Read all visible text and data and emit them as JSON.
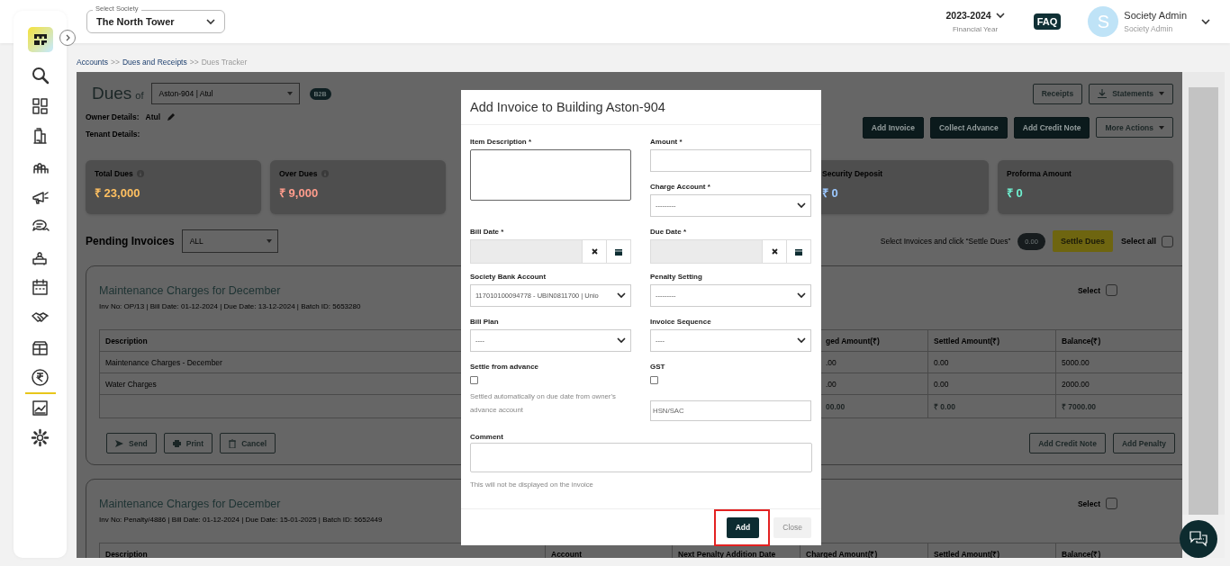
{
  "topbar": {
    "society_select": {
      "label": "Select Society",
      "value": "The North Tower"
    },
    "financial_year": {
      "value": "2023-2024",
      "caption": "Financial Year"
    },
    "faq": "FAQ",
    "user": {
      "initial": "S",
      "name": "Society Admin",
      "role": "Society Admin"
    }
  },
  "sidebar": {
    "items": [
      {
        "selected": false
      },
      {
        "selected": false
      },
      {
        "selected": false
      },
      {
        "selected": false
      },
      {
        "selected": false
      },
      {
        "selected": false
      },
      {
        "selected": false
      },
      {
        "selected": false
      },
      {
        "selected": false
      },
      {
        "selected": false
      },
      {
        "selected": true
      },
      {
        "selected": false
      },
      {
        "selected": false
      }
    ]
  },
  "breadcrumb": [
    {
      "label": "Accounts",
      "kind": "link"
    },
    {
      "label": ">>",
      "kind": "separator"
    },
    {
      "label": "Dues and Receipts",
      "kind": "link"
    },
    {
      "label": ">>",
      "kind": "separator"
    },
    {
      "label": "Dues Tracker",
      "kind": "current"
    }
  ],
  "dues": {
    "title": "Dues",
    "of": "of",
    "unit_select": "Aston-904 | Atul",
    "badge": "B2B",
    "owner_label": "Owner Details:",
    "owner": "Atul",
    "tenant_label": "Tenant Details:",
    "top_buttons": [
      {
        "label": "Receipts",
        "kind": "outline"
      },
      {
        "label": "Statements",
        "kind": "download"
      }
    ],
    "actions": [
      {
        "label": "Add Invoice",
        "kind": "solid"
      },
      {
        "label": "Collect Advance",
        "kind": "solid"
      },
      {
        "label": "Add Credit Note",
        "kind": "solid"
      },
      {
        "label": "More Actions",
        "kind": "dropdown"
      }
    ]
  },
  "summary_cards": [
    {
      "title": "Total Dues",
      "info": true,
      "value": "₹ 23,000",
      "color": "#ffc061"
    },
    {
      "title": "Over Dues",
      "info": true,
      "value": "₹ 9,000",
      "color": "#ff9c8c"
    },
    {
      "title": "Security Deposit",
      "info": false,
      "value": "₹ 0",
      "color": "#9cc8ff"
    },
    {
      "title": "Proforma Amount",
      "info": false,
      "value": "₹ 0",
      "color": "#6ff0d0"
    }
  ],
  "pending": {
    "title": "Pending Invoices",
    "filter": "ALL",
    "hint": "Select Invoices and click “Settle Dues”",
    "total": "0.00",
    "settle_button": "Settle Dues",
    "select_all_label": "Select all",
    "select_all_checked": false
  },
  "invoices": [
    {
      "title": "Maintenance Charges for December",
      "meta": "Inv No: OP/13 | Bill Date: 01-12-2024 | Due Date: 13-12-2024 | Batch ID: 5653280",
      "select_label": "Select",
      "checked": false,
      "columns": {
        "description": "Description",
        "charged_amount": "ged Amount(₹)",
        "settled_amount": "Settled Amount(₹)",
        "balance": "Balance(₹)"
      },
      "rows": [
        {
          "description": "Maintenance Charges - December",
          "charged_amount": ".00",
          "settled_amount": "0.00",
          "balance": "5000.00"
        },
        {
          "description": "Water Charges",
          "charged_amount": ".00",
          "settled_amount": "0.00",
          "balance": "2000.00"
        }
      ],
      "total": {
        "charged_amount": "00.00",
        "settled_amount": "₹ 0.00",
        "balance": "₹ 7000.00"
      },
      "left_buttons": [
        {
          "label": "Send",
          "kind": "send"
        },
        {
          "label": "Print",
          "kind": "print"
        },
        {
          "label": "Cancel",
          "kind": "cancel"
        }
      ],
      "right_buttons": [
        "Add Credit Note",
        "Add Penalty"
      ]
    },
    {
      "title": "Maintenance Charges for December",
      "meta": "Inv No: Penalty/4886 | Bill Date: 01-12-2024 | Due Date: 15-01-2025 | Batch ID: 5652449",
      "select_label": "Select",
      "checked": false,
      "columns": {
        "description": "Description",
        "account": "Account",
        "next_penalty_date": "Next Penalty Addition Date",
        "charged_amount": "Charged Amount(₹)",
        "settled_amount": "Settled Amount(₹)",
        "balance": "Balance(₹)"
      }
    }
  ],
  "modal": {
    "title": "Add Invoice to Building Aston-904",
    "fields": [
      {
        "kind": "textarea",
        "label": "Item Description *"
      },
      {
        "kind": "input",
        "label": "Amount *"
      },
      {
        "kind": "select",
        "label": "Charge Account *",
        "value": "---------"
      },
      {
        "kind": "date",
        "label": "Bill Date *"
      },
      {
        "kind": "date",
        "label": "Due Date *"
      },
      {
        "kind": "select",
        "label": "Society Bank Account",
        "value": "117010100094778 - UBIN0811700 | Unio"
      },
      {
        "kind": "select",
        "label": "Penalty Setting",
        "value": "---------"
      },
      {
        "kind": "select",
        "label": "Bill Plan",
        "value": "----"
      },
      {
        "kind": "select",
        "label": "Invoice Sequence",
        "value": "----"
      },
      {
        "kind": "checkbox",
        "label": "Settle from advance",
        "checked": false,
        "note": "Settled automatically on due date from owner's advance account"
      },
      {
        "kind": "checkbox",
        "label": "GST",
        "checked": false,
        "placeholder": "HSN/SAC"
      }
    ],
    "comment_label": "Comment",
    "comment_hint": "This will not be displayed on the invoice",
    "buttons": [
      {
        "label": "Add",
        "kind": "primary",
        "highlighted": true
      },
      {
        "label": "Close",
        "kind": "secondary",
        "highlighted": false
      }
    ]
  }
}
